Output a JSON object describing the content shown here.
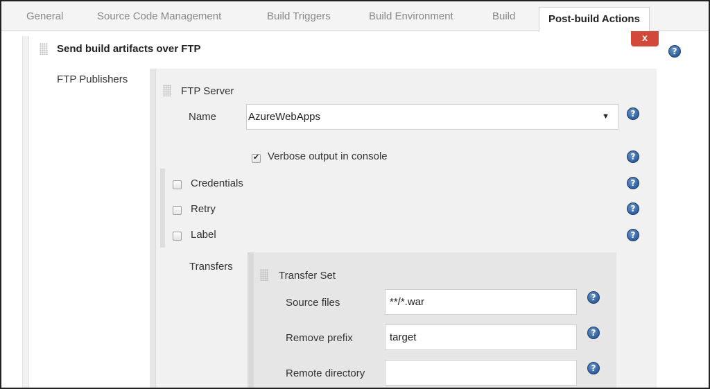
{
  "tabs": [
    {
      "label": "General"
    },
    {
      "label": "Source Code Management"
    },
    {
      "label": "Build Triggers"
    },
    {
      "label": "Build Environment"
    },
    {
      "label": "Build"
    },
    {
      "label": "Post-build Actions"
    }
  ],
  "section": {
    "title": "Send build artifacts over FTP",
    "delete_label": "x",
    "publishers_label": "FTP Publishers"
  },
  "ftp_server": {
    "title": "FTP Server",
    "name_label": "Name",
    "name_value": "AzureWebApps",
    "verbose_label": "Verbose output in console",
    "verbose_checked": true,
    "credentials_label": "Credentials",
    "retry_label": "Retry",
    "label_label": "Label"
  },
  "transfers": {
    "label": "Transfers",
    "set_title": "Transfer Set",
    "source_files_label": "Source files",
    "source_files_value": "**/*.war",
    "remove_prefix_label": "Remove prefix",
    "remove_prefix_value": "target",
    "remote_directory_label": "Remote directory",
    "remote_directory_value": ""
  },
  "help_icon": "question-mark",
  "colors": {
    "delete_button": "#d24939",
    "help_icon": "#2e5f9f",
    "panel_bg": "#f1f1f1"
  }
}
